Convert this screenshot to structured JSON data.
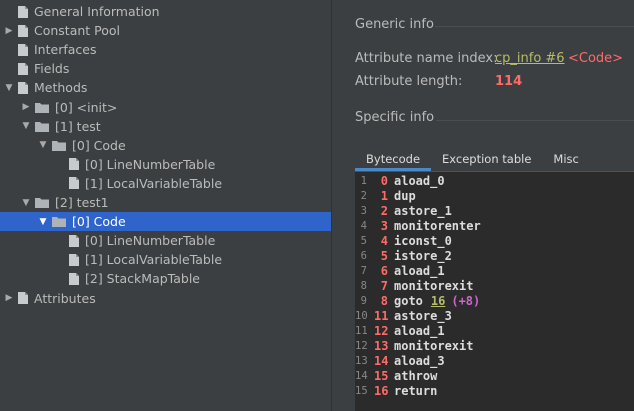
{
  "tree": {
    "items": [
      {
        "label": "General Information",
        "arrow": "",
        "icon": "file",
        "indent": 0
      },
      {
        "label": "Constant Pool",
        "arrow": "right",
        "icon": "file",
        "indent": 0
      },
      {
        "label": "Interfaces",
        "arrow": "",
        "icon": "file",
        "indent": 0
      },
      {
        "label": "Fields",
        "arrow": "",
        "icon": "file",
        "indent": 0
      },
      {
        "label": "Methods",
        "arrow": "down",
        "icon": "file",
        "indent": 0
      },
      {
        "label": "[0] <init>",
        "arrow": "right",
        "icon": "folder",
        "indent": 1
      },
      {
        "label": "[1] test",
        "arrow": "down",
        "icon": "folder",
        "indent": 1
      },
      {
        "label": "[0] Code",
        "arrow": "down",
        "icon": "folder",
        "indent": 2
      },
      {
        "label": "[0] LineNumberTable",
        "arrow": "",
        "icon": "file",
        "indent": 3
      },
      {
        "label": "[1] LocalVariableTable",
        "arrow": "",
        "icon": "file",
        "indent": 3
      },
      {
        "label": "[2] test1",
        "arrow": "down",
        "icon": "folder",
        "indent": 1
      },
      {
        "label": "[0] Code",
        "arrow": "down",
        "icon": "folder",
        "indent": 2,
        "selected": true
      },
      {
        "label": "[0] LineNumberTable",
        "arrow": "",
        "icon": "file",
        "indent": 3
      },
      {
        "label": "[1] LocalVariableTable",
        "arrow": "",
        "icon": "file",
        "indent": 3
      },
      {
        "label": "[2] StackMapTable",
        "arrow": "",
        "icon": "file",
        "indent": 3
      },
      {
        "label": "Attributes",
        "arrow": "right",
        "icon": "file",
        "indent": 0
      }
    ]
  },
  "generic": {
    "title": "Generic info",
    "name_index_label": "Attribute name index:",
    "name_index_link": "cp_info #6",
    "name_index_value": "<Code>",
    "length_label": "Attribute length:",
    "length_value": "114"
  },
  "specific": {
    "title": "Specific info",
    "tabs": [
      "Bytecode",
      "Exception table",
      "Misc"
    ],
    "active_tab": 0
  },
  "bytecode": [
    {
      "line": "1",
      "offset": "0",
      "instr": "aload_0"
    },
    {
      "line": "2",
      "offset": "1",
      "instr": "dup"
    },
    {
      "line": "3",
      "offset": "2",
      "instr": "astore_1"
    },
    {
      "line": "4",
      "offset": "3",
      "instr": "monitorenter"
    },
    {
      "line": "5",
      "offset": "4",
      "instr": "iconst_0"
    },
    {
      "line": "6",
      "offset": "5",
      "instr": "istore_2"
    },
    {
      "line": "7",
      "offset": "6",
      "instr": "aload_1"
    },
    {
      "line": "8",
      "offset": "7",
      "instr": "monitorexit"
    },
    {
      "line": "9",
      "offset": "8",
      "instr": "goto",
      "arg": "16",
      "rel": "(+8)"
    },
    {
      "line": "10",
      "offset": "11",
      "instr": "astore_3"
    },
    {
      "line": "11",
      "offset": "12",
      "instr": "aload_1"
    },
    {
      "line": "12",
      "offset": "13",
      "instr": "monitorexit"
    },
    {
      "line": "13",
      "offset": "14",
      "instr": "aload_3"
    },
    {
      "line": "14",
      "offset": "15",
      "instr": "athrow"
    },
    {
      "line": "15",
      "offset": "16",
      "instr": "return"
    }
  ],
  "colors": {
    "background": "#3c3f41",
    "selection": "#2f65ca",
    "code_background": "#2b2b2b",
    "offset": "#ff6b68",
    "link": "#b5bd68",
    "relative": "#cc66cc"
  }
}
